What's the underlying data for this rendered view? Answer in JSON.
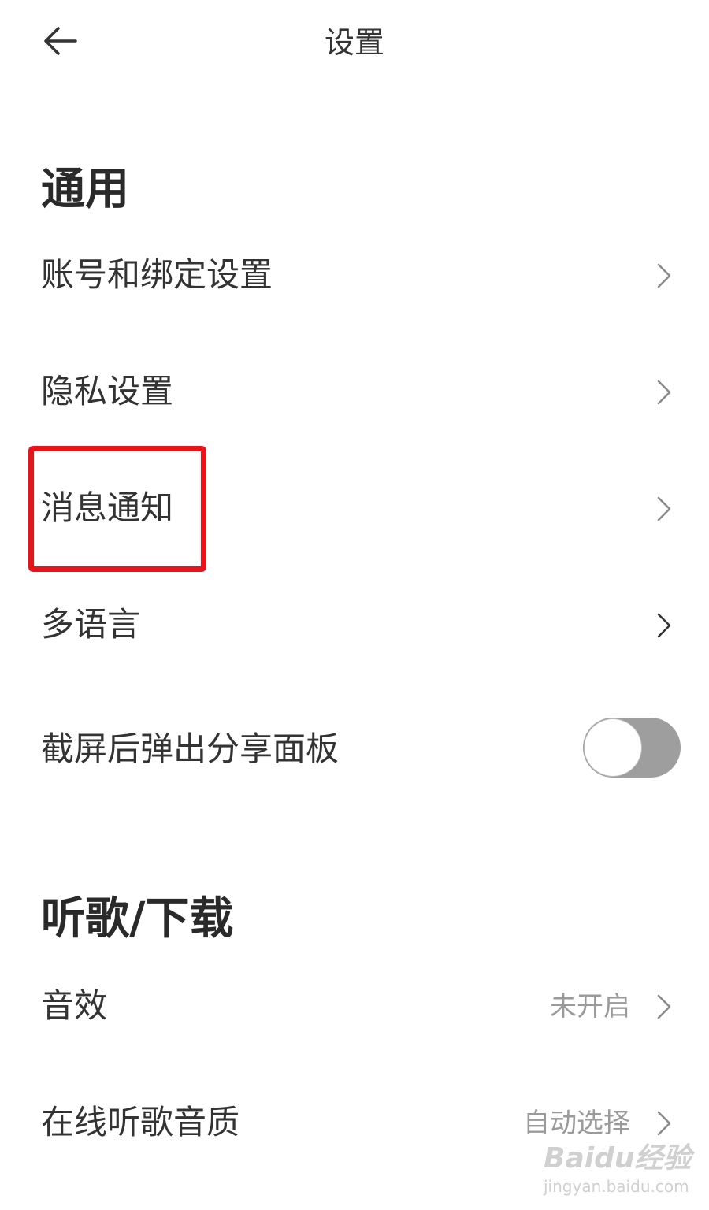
{
  "header": {
    "title": "设置",
    "back_icon": "arrow-left-icon"
  },
  "sections": [
    {
      "title": "通用",
      "items": [
        {
          "label": "账号和绑定设置",
          "control": "chevron"
        },
        {
          "label": "隐私设置",
          "control": "chevron"
        },
        {
          "label": "消息通知",
          "control": "chevron",
          "highlighted": true
        },
        {
          "label": "多语言",
          "control": "chevron"
        },
        {
          "label": "截屏后弹出分享面板",
          "control": "toggle",
          "toggle_on": false
        }
      ]
    },
    {
      "title": "听歌/下载",
      "items": [
        {
          "label": "音效",
          "value": "未开启",
          "control": "chevron"
        },
        {
          "label": "在线听歌音质",
          "value": "自动选择",
          "control": "chevron"
        }
      ]
    }
  ],
  "annotation": {
    "highlight_color": "#e8141b"
  },
  "watermark": {
    "logo_text": "Baidu经验",
    "url_text": "jingyan.baidu.com"
  }
}
